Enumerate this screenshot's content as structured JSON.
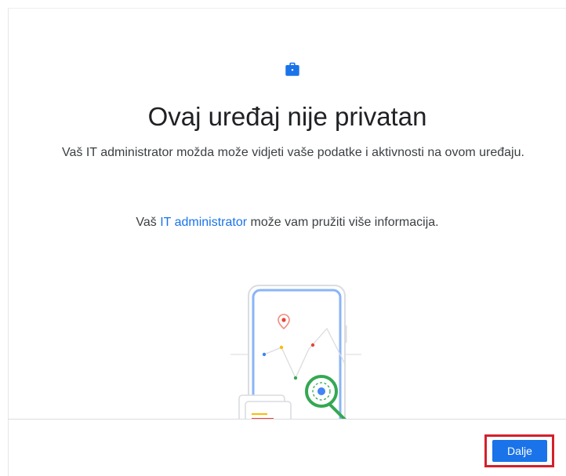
{
  "header": {
    "icon": "briefcase-icon"
  },
  "main": {
    "title": "Ovaj uređaj nije privatan",
    "subtitle": "Vaš IT administrator možda može vidjeti vaše podatke i aktivnosti na ovom uređaju.",
    "info_prefix": "Vaš ",
    "info_link": "IT administrator",
    "info_suffix": " može vam pružiti više informacija.",
    "illustration": "phone-magnifier-illustration"
  },
  "footer": {
    "next_label": "Dalje"
  },
  "colors": {
    "accent": "#1a73e8",
    "highlight": "#d4202a",
    "magnifier": "#34a853"
  }
}
